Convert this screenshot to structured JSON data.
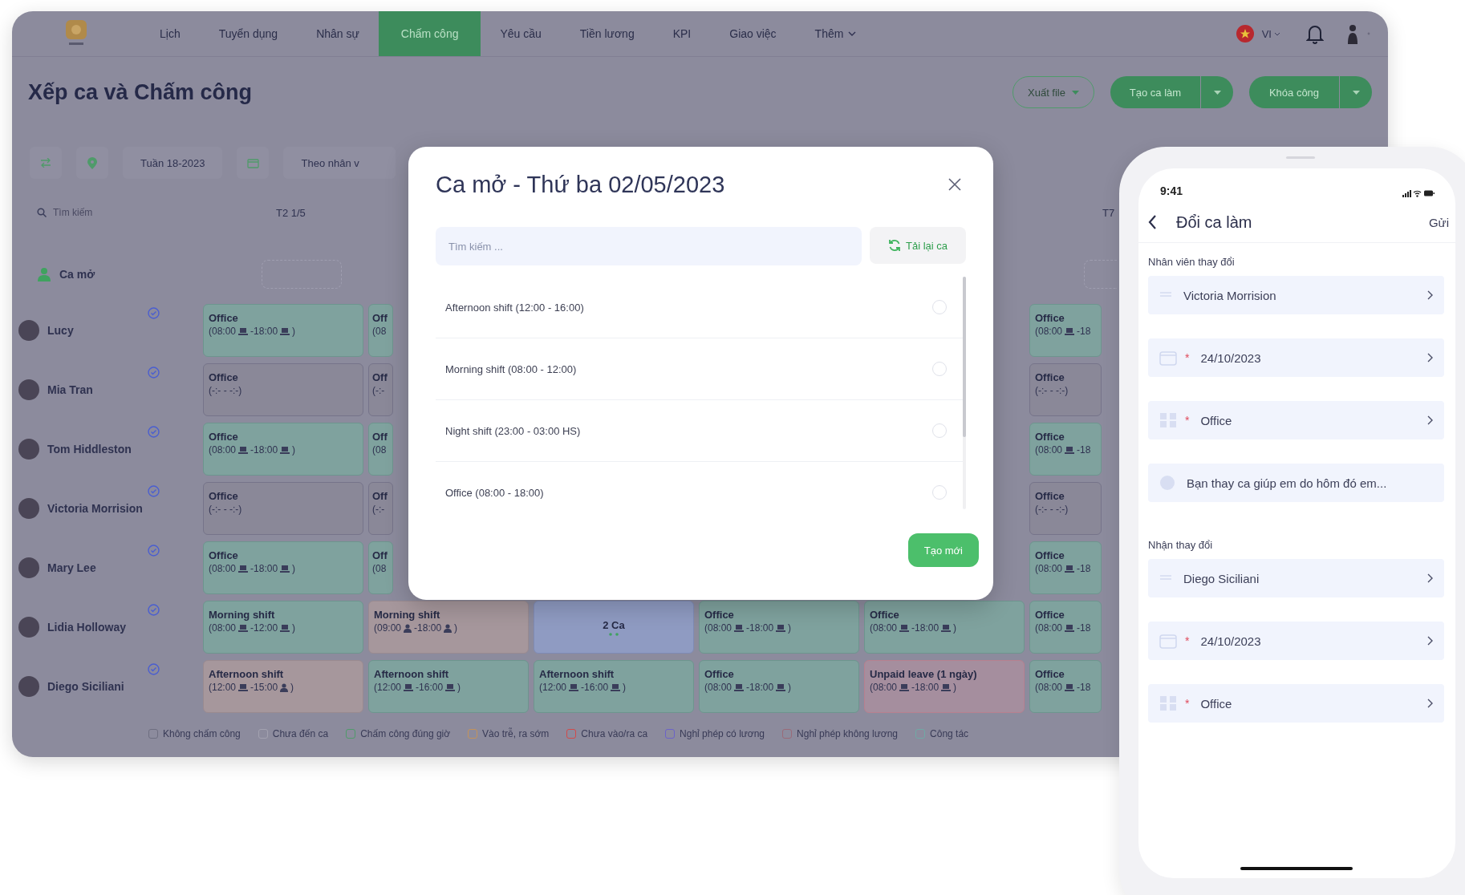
{
  "nav": {
    "items": [
      {
        "label": "Lịch",
        "selected": false,
        "dropdown": false
      },
      {
        "label": "Tuyển dụng",
        "selected": false,
        "dropdown": false
      },
      {
        "label": "Nhân sự",
        "selected": false,
        "dropdown": false
      },
      {
        "label": "Chấm công",
        "selected": true,
        "dropdown": false
      },
      {
        "label": "Yêu cầu",
        "selected": false,
        "dropdown": false
      },
      {
        "label": "Tiền lương",
        "selected": false,
        "dropdown": false
      },
      {
        "label": "KPI",
        "selected": false,
        "dropdown": false
      },
      {
        "label": "Giao việc",
        "selected": false,
        "dropdown": false
      },
      {
        "label": "Thêm",
        "selected": false,
        "dropdown": true
      }
    ],
    "language": "VI"
  },
  "page_title": "Xếp ca và Chấm công",
  "actions": {
    "export": "Xuất file",
    "create_shift": "Tạo ca làm",
    "lock": "Khóa công"
  },
  "toolbar": {
    "week": "Tuần 18-2023",
    "group_by": "Theo nhân v"
  },
  "table": {
    "search_placeholder": "Tìm kiếm",
    "columns": [
      {
        "label": "T2 1/5"
      },
      {
        "label": "T7"
      }
    ],
    "open_shift_row": {
      "label": "Ca mở"
    },
    "rows": [
      {
        "name": "Lucy",
        "cells": [
          {
            "kind": "ok",
            "title": "Office",
            "time": [
              {
                "text": "(08:00",
                "kind": "laptop"
              },
              {
                "text": "-18:00",
                "kind": "laptop"
              },
              {
                "text": ")"
              }
            ]
          },
          {
            "kind": "ok",
            "title": "Off",
            "time": [
              {
                "text": "(08"
              }
            ]
          },
          {
            "kind": "ok",
            "title": "Office",
            "time": [
              {
                "text": "(08:00",
                "kind": "laptop"
              },
              {
                "text": "-18"
              }
            ]
          }
        ]
      },
      {
        "name": "Mia Tran",
        "cells": [
          {
            "kind": "absent",
            "title": "Office",
            "time": [
              {
                "text": "(-:- - -:-)"
              }
            ]
          },
          {
            "kind": "absent",
            "title": "Off",
            "time": [
              {
                "text": "(-:-"
              }
            ]
          },
          {
            "kind": "absent",
            "title": "Office",
            "time": [
              {
                "text": "(-:- - -:-)"
              }
            ]
          }
        ]
      },
      {
        "name": "Tom Hiddleston",
        "cells": [
          {
            "kind": "ok",
            "title": "Office",
            "time": [
              {
                "text": "(08:00",
                "kind": "laptop"
              },
              {
                "text": "-18:00",
                "kind": "laptop"
              },
              {
                "text": ")"
              }
            ]
          },
          {
            "kind": "ok",
            "title": "Off",
            "time": [
              {
                "text": "(08"
              }
            ]
          },
          {
            "kind": "ok",
            "title": "Office",
            "time": [
              {
                "text": "(08:00",
                "kind": "laptop"
              },
              {
                "text": "-18"
              }
            ]
          }
        ]
      },
      {
        "name": "Victoria Morrision",
        "cells": [
          {
            "kind": "absent",
            "title": "Office",
            "time": [
              {
                "text": "(-:- - -:-)"
              }
            ]
          },
          {
            "kind": "absent",
            "title": "Off",
            "time": [
              {
                "text": "(-:-"
              }
            ]
          },
          {
            "kind": "absent",
            "title": "Office",
            "time": [
              {
                "text": "(-:- - -:-)"
              }
            ]
          }
        ]
      },
      {
        "name": "Mary Lee",
        "cells": [
          {
            "kind": "ok",
            "title": "Office",
            "time": [
              {
                "text": "(08:00",
                "kind": "laptop"
              },
              {
                "text": "-18:00",
                "kind": "laptop"
              },
              {
                "text": ")"
              }
            ]
          },
          {
            "kind": "ok",
            "title": "Off",
            "time": [
              {
                "text": "(08"
              }
            ]
          },
          {
            "kind": "ok",
            "title": "Office",
            "time": [
              {
                "text": "(08:00",
                "kind": "laptop"
              },
              {
                "text": "-18"
              }
            ]
          }
        ]
      },
      {
        "name": "Lidia Holloway",
        "cells": [
          {
            "kind": "ok",
            "title": "Morning shift",
            "time": [
              {
                "text": "(08:00",
                "kind": "laptop"
              },
              {
                "text": "-12:00",
                "kind": "laptop"
              },
              {
                "text": ")"
              }
            ]
          },
          {
            "kind": "late",
            "title": "Morning shift",
            "time": [
              {
                "text": "(09:00",
                "kind": "person"
              },
              {
                "text": "-18:00",
                "kind": "person"
              },
              {
                "text": ")"
              }
            ]
          },
          {
            "kind": "multi",
            "title": "2 Ca"
          },
          {
            "kind": "ok",
            "title": "Office",
            "time": [
              {
                "text": "(08:00",
                "kind": "laptop"
              },
              {
                "text": "-18:00",
                "kind": "laptop"
              },
              {
                "text": ")"
              }
            ]
          },
          {
            "kind": "ok",
            "title": "Office",
            "time": [
              {
                "text": "(08:00",
                "kind": "laptop"
              },
              {
                "text": "-18:00",
                "kind": "laptop"
              },
              {
                "text": ")"
              }
            ]
          },
          {
            "kind": "ok",
            "title": "Office",
            "time": [
              {
                "text": "(08:00",
                "kind": "laptop"
              },
              {
                "text": "-18"
              }
            ]
          }
        ]
      },
      {
        "name": "Diego Siciliani",
        "cells": [
          {
            "kind": "late",
            "title": "Afternoon shift",
            "time": [
              {
                "text": "(12:00",
                "kind": "laptop"
              },
              {
                "text": "-15:00",
                "kind": "person"
              },
              {
                "text": ")"
              }
            ]
          },
          {
            "kind": "ok",
            "title": "Afternoon shift",
            "time": [
              {
                "text": "(12:00",
                "kind": "laptop"
              },
              {
                "text": "-16:00",
                "kind": "laptop"
              },
              {
                "text": ")"
              }
            ]
          },
          {
            "kind": "ok",
            "title": "Afternoon shift",
            "time": [
              {
                "text": "(12:00",
                "kind": "laptop"
              },
              {
                "text": "-16:00",
                "kind": "laptop"
              },
              {
                "text": ")"
              }
            ]
          },
          {
            "kind": "ok",
            "title": "Office",
            "time": [
              {
                "text": "(08:00",
                "kind": "laptop"
              },
              {
                "text": "-18:00",
                "kind": "laptop"
              },
              {
                "text": ")"
              }
            ]
          },
          {
            "kind": "leave",
            "title": "Unpaid leave (1 ngày)",
            "time": [
              {
                "text": "(08:00",
                "kind": "laptop"
              },
              {
                "text": "-18:00",
                "kind": "laptop"
              },
              {
                "text": ")"
              }
            ]
          },
          {
            "kind": "ok",
            "title": "Office",
            "time": [
              {
                "text": "(08:00",
                "kind": "laptop"
              },
              {
                "text": "-18"
              }
            ]
          }
        ]
      }
    ]
  },
  "legend": [
    {
      "label": "Không chấm công",
      "color": "#6e6e80"
    },
    {
      "label": "Chưa đến ca",
      "color": "#a3a2b0"
    },
    {
      "label": "Chấm công đúng giờ",
      "color": "#4f9b6a"
    },
    {
      "label": "Vào trễ, ra sớm",
      "color": "#c4935a"
    },
    {
      "label": "Chưa vào/ra ca",
      "color": "#d24a4a"
    },
    {
      "label": "Nghỉ phép có lương",
      "color": "#6b62c9"
    },
    {
      "label": "Nghỉ phép không lương",
      "color": "#9a6a78"
    },
    {
      "label": "Công tác",
      "color": "#6fa9a5"
    }
  ],
  "modal": {
    "title": "Ca mở - Thứ ba 02/05/2023",
    "search_placeholder": "Tìm kiếm ...",
    "reload": "Tải lại ca",
    "shifts": [
      {
        "label": "Afternoon shift (12:00 - 16:00)",
        "selected": false
      },
      {
        "label": "Morning shift (08:00 - 12:00)",
        "selected": false
      },
      {
        "label": "Night shift (23:00 - 03:00 HS)",
        "selected": false
      },
      {
        "label": "Office (08:00 - 18:00)",
        "selected": false
      }
    ],
    "create": "Tạo mới"
  },
  "phone": {
    "time": "9:41",
    "title": "Đổi ca làm",
    "send": "Gửi",
    "sections": [
      {
        "label": "Nhân viên thay đổi",
        "fields": [
          {
            "kind": "person",
            "value": "Victoria Morrision"
          },
          {
            "kind": "date",
            "required_mark": "*",
            "value": "24/10/2023"
          },
          {
            "kind": "shift",
            "required_mark": "*",
            "value": "Office"
          },
          {
            "kind": "note",
            "value": "Bạn thay ca giúp em do hôm đó em..."
          }
        ]
      },
      {
        "label": "Nhận thay đổi",
        "fields": [
          {
            "kind": "person",
            "value": "Diego Siciliani"
          },
          {
            "kind": "date",
            "required_mark": "*",
            "value": "24/10/2023"
          },
          {
            "kind": "shift",
            "required_mark": "*",
            "value": "Office"
          }
        ]
      }
    ]
  }
}
